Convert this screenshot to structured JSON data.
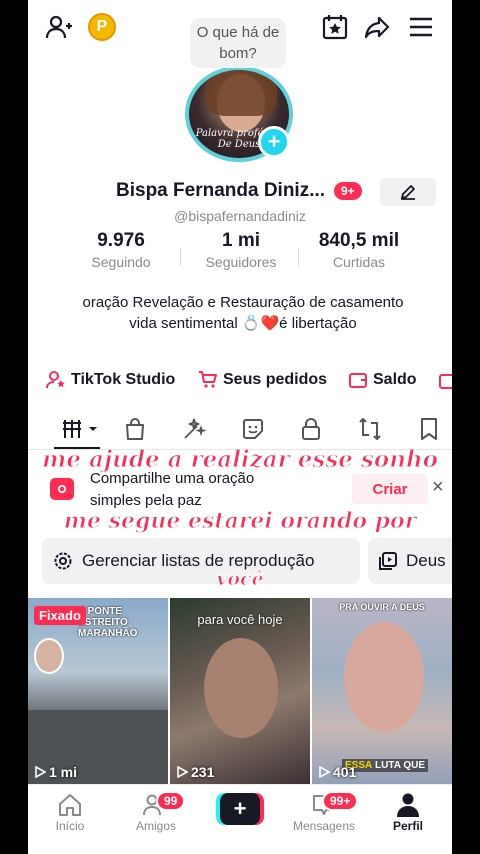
{
  "topbar": {
    "coin_letter": "P",
    "bubble_text": "O que há de bom?"
  },
  "profile": {
    "avatar_caption": "Palavra profética De Deus",
    "name": "Bispa Fernanda Diniz...",
    "name_badge": "9+",
    "handle": "@bispafernandadiniz",
    "stats": [
      {
        "value": "9.976",
        "label": "Seguindo"
      },
      {
        "value": "1 mi",
        "label": "Seguidores"
      },
      {
        "value": "840,5 mil",
        "label": "Curtidas"
      }
    ],
    "bio": "oração Revelação e Restauração de casamento vida sentimental 💍❤️é libertação"
  },
  "quick_links": [
    {
      "label": "TikTok Studio",
      "icon": "person-star-icon"
    },
    {
      "label": "Seus pedidos",
      "icon": "cart-icon"
    },
    {
      "label": "Saldo",
      "icon": "wallet-icon"
    }
  ],
  "tabs": [
    "grid-icon",
    "shopping-bag-icon",
    "sparkle-icon",
    "sticker-icon",
    "lock-icon",
    "repost-icon",
    "bookmark-icon"
  ],
  "overlay_text": {
    "line1": "me ajude a realizar esse sonho",
    "line2": "me segue estarei orando por",
    "line3": "você"
  },
  "share_prompt": {
    "text": "Compartilhe uma oração simples pela paz",
    "button": "Criar",
    "close": "×"
  },
  "playlists": [
    {
      "label": "Gerenciar listas de reprodução",
      "icon": "gear-icon"
    },
    {
      "label": "Deus",
      "icon": "playlist-icon"
    }
  ],
  "videos": [
    {
      "badge": "Fixado",
      "top_text": "A PONTE ESTREITO MARANHÃO",
      "views": "1 mi"
    },
    {
      "top_text": "para você hoje",
      "views": "231"
    },
    {
      "top_text": "PRA OUVIR A DEUS",
      "caption_prefix": "ESSA",
      "caption_rest": " LUTA QUE",
      "views": "401"
    }
  ],
  "bottom_nav": [
    {
      "label": "Início",
      "icon": "home-icon"
    },
    {
      "label": "Amigos",
      "icon": "friends-icon",
      "badge": "99"
    },
    {
      "label": "",
      "icon": "create-icon"
    },
    {
      "label": "Mensagens",
      "icon": "inbox-icon",
      "badge": "99+"
    },
    {
      "label": "Perfil",
      "icon": "profile-icon"
    }
  ],
  "colors": {
    "accent": "#fe2c55",
    "cyan": "#20d5ec"
  }
}
